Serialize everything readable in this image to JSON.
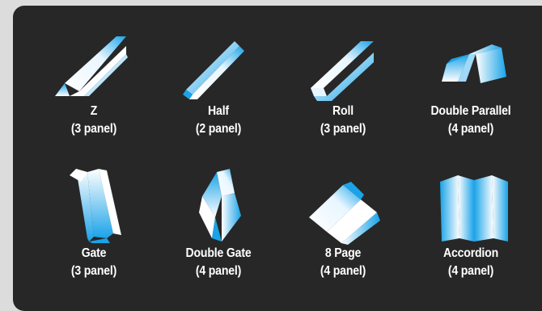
{
  "colors": {
    "background": "#dcdcdc",
    "panel": "#272727",
    "fold_blue": "#1aa3e8",
    "fold_white": "#ffffff",
    "text": "#ffffff"
  },
  "folds": [
    {
      "id": "z",
      "icon": "z-fold-icon",
      "name": "Z",
      "panels": "(3 panel)"
    },
    {
      "id": "half",
      "icon": "half-fold-icon",
      "name": "Half",
      "panels": "(2 panel)"
    },
    {
      "id": "roll",
      "icon": "roll-fold-icon",
      "name": "Roll",
      "panels": "(3 panel)"
    },
    {
      "id": "double-parallel",
      "icon": "double-parallel-fold-icon",
      "name": "Double Parallel",
      "panels": "(4 panel)"
    },
    {
      "id": "gate",
      "icon": "gate-fold-icon",
      "name": "Gate",
      "panels": "(3 panel)"
    },
    {
      "id": "double-gate",
      "icon": "double-gate-fold-icon",
      "name": "Double Gate",
      "panels": "(4 panel)"
    },
    {
      "id": "8-page",
      "icon": "8-page-fold-icon",
      "name": "8 Page",
      "panels": "(4 panel)"
    },
    {
      "id": "accordion",
      "icon": "accordion-fold-icon",
      "name": "Accordion",
      "panels": "(4 panel)"
    }
  ]
}
